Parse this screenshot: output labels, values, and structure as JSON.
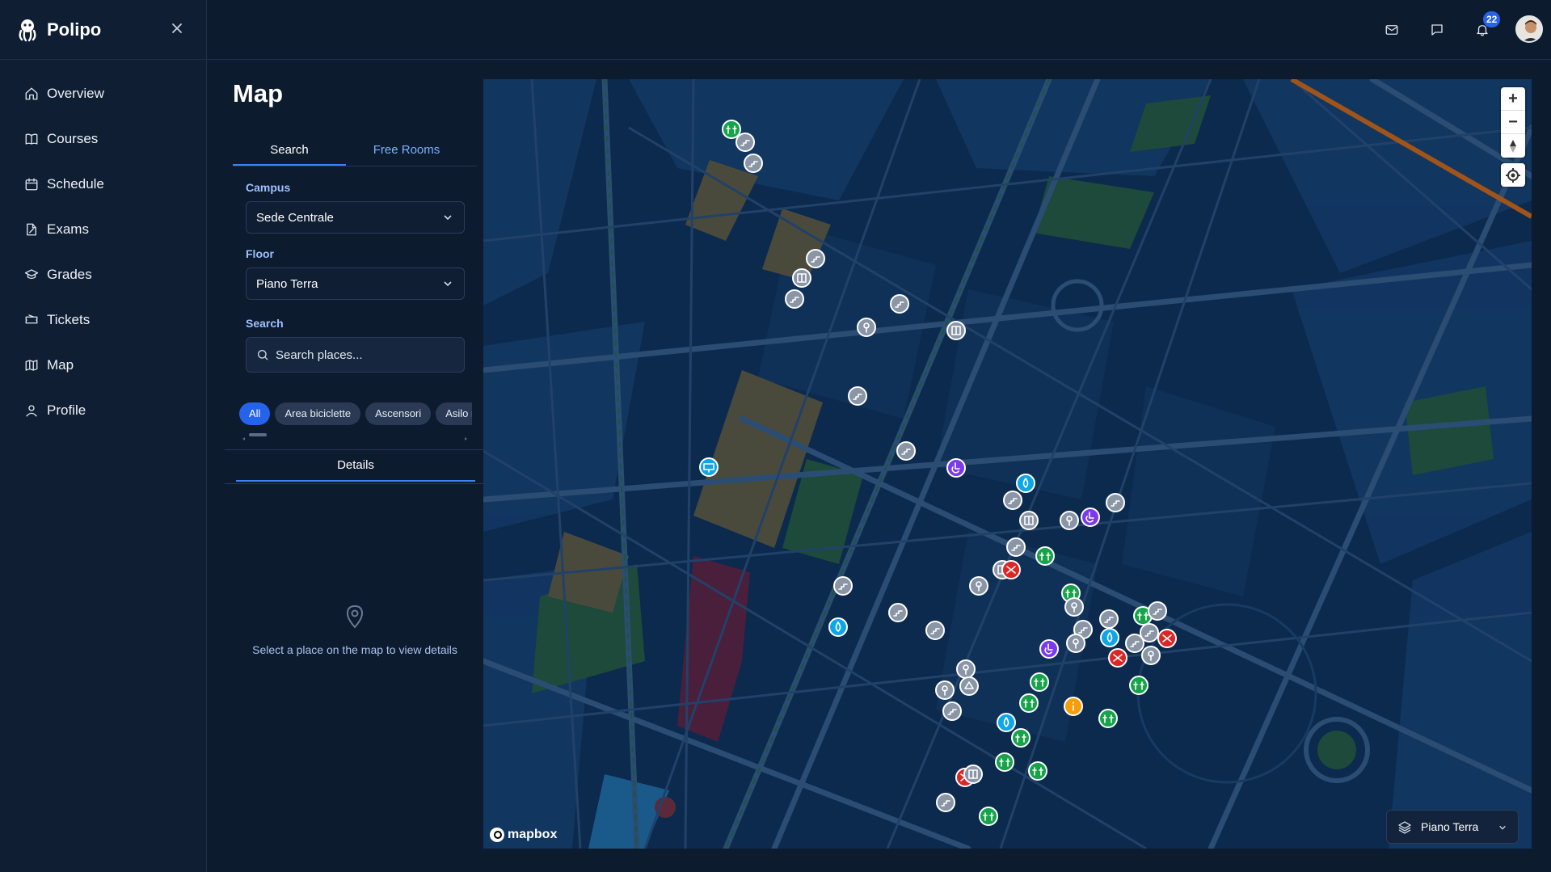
{
  "brand": {
    "name": "Polipo",
    "close_icon": "close-icon"
  },
  "sidebar": {
    "items": [
      {
        "label": "Overview",
        "icon": "home-icon"
      },
      {
        "label": "Courses",
        "icon": "book-icon"
      },
      {
        "label": "Schedule",
        "icon": "calendar-icon"
      },
      {
        "label": "Exams",
        "icon": "edit-document-icon"
      },
      {
        "label": "Grades",
        "icon": "graduation-cap-icon"
      },
      {
        "label": "Tickets",
        "icon": "ticket-icon"
      },
      {
        "label": "Map",
        "icon": "map-icon"
      },
      {
        "label": "Profile",
        "icon": "user-icon"
      }
    ]
  },
  "header": {
    "icons": [
      "mail-icon",
      "chat-icon",
      "bell-icon"
    ],
    "notifications_count": "22"
  },
  "page": {
    "title": "Map"
  },
  "tabs": [
    {
      "label": "Search",
      "active": true
    },
    {
      "label": "Free Rooms",
      "active": false
    }
  ],
  "form": {
    "campus_label": "Campus",
    "campus_value": "Sede Centrale",
    "floor_label": "Floor",
    "floor_value": "Piano Terra",
    "search_label": "Search",
    "search_placeholder": "Search places..."
  },
  "filters": [
    "All",
    "Area biciclette",
    "Ascensori",
    "Asilo n"
  ],
  "details": {
    "tab_label": "Details",
    "empty_message": "Select a place on the map to view details"
  },
  "map": {
    "attribution": "mapbox",
    "floor_selector": "Piano Terra",
    "controls": [
      "zoom-in",
      "zoom-out",
      "compass",
      "geolocate"
    ],
    "colors": {
      "background": "#0c2a4d",
      "marker_gray": "#8a95a5",
      "marker_green": "#16a34a",
      "marker_blue": "#0ea5e9",
      "marker_red": "#dc2626",
      "marker_purple": "#7c3aed",
      "marker_orange": "#f59e0b"
    }
  }
}
